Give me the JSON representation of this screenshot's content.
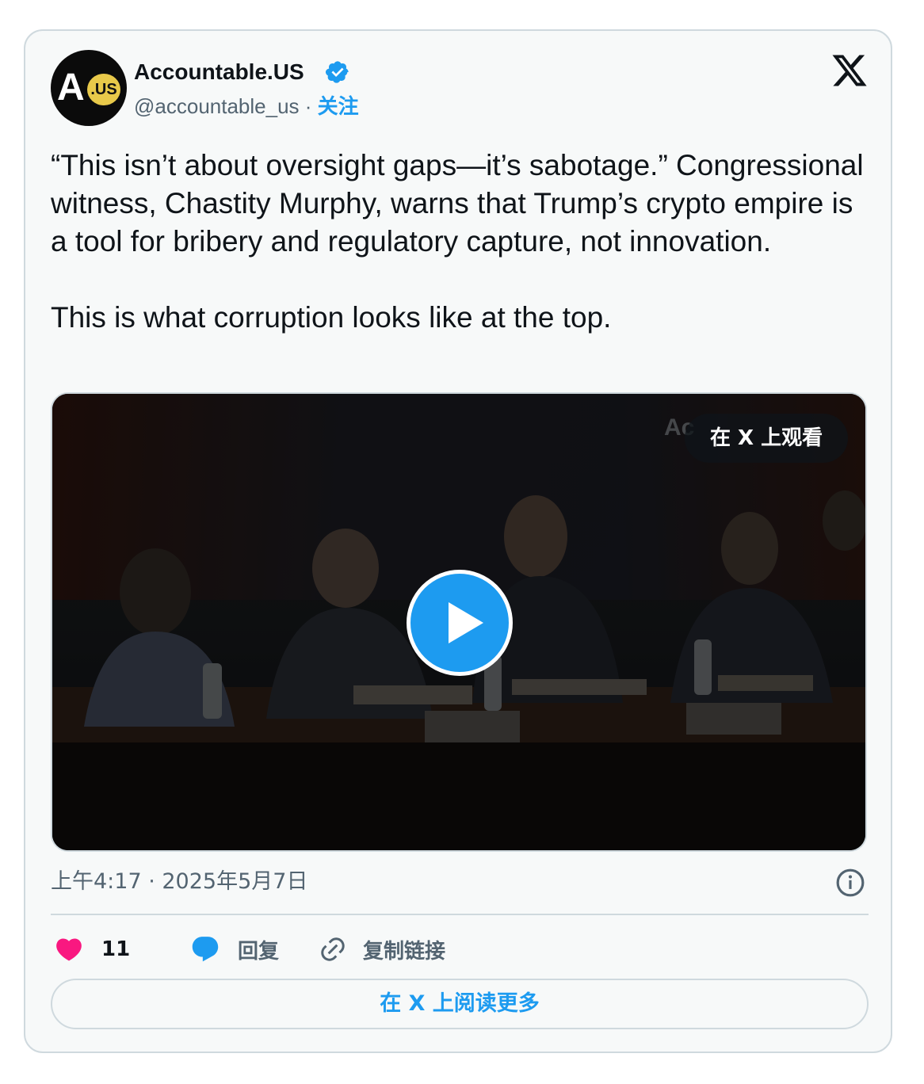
{
  "author": {
    "name": "Accountable.US",
    "handle": "@accountable_us",
    "separator": " · ",
    "follow_label": "关注",
    "avatar_letter": "A",
    "avatar_badge": ".US"
  },
  "tweet": {
    "text": "“This isn’t about oversight gaps—it’s sabotage.” Congressional witness, Chastity Murphy, warns that Trump’s crypto empire is a tool for bribery and regulatory capture, not innovation.\n\nThis is what corruption looks like at the top."
  },
  "media": {
    "watch_label": "在 X 上观看"
  },
  "meta": {
    "timestamp": "上午4:17 · 2025年5月7日"
  },
  "actions": {
    "like_count": "11",
    "reply_label": "回复",
    "copy_link_label": "复制链接"
  },
  "read_more_label": "在 X 上阅读更多",
  "colors": {
    "accent": "#1d9bf0",
    "like": "#f91880",
    "muted": "#536471",
    "border": "#cfd9de",
    "card_bg": "#f7f9f9"
  },
  "icons": [
    "verified-badge-icon",
    "x-logo-icon",
    "play-icon",
    "info-icon",
    "heart-icon",
    "reply-bubble-icon",
    "link-icon"
  ]
}
